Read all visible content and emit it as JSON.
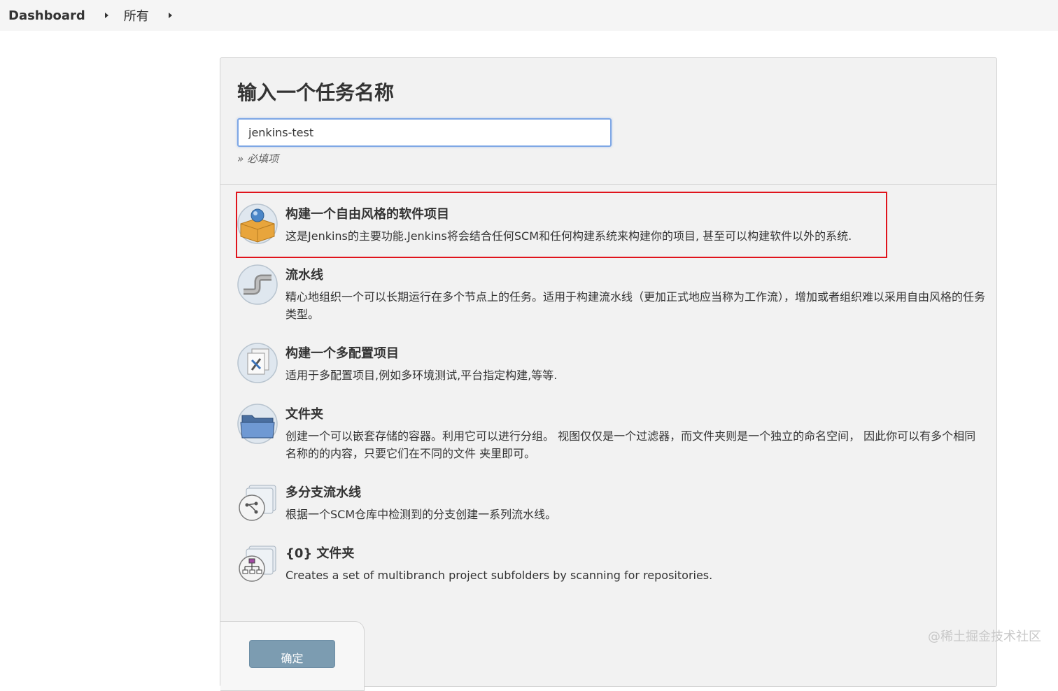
{
  "breadcrumb": {
    "items": [
      "Dashboard",
      "所有"
    ]
  },
  "form": {
    "title": "输入一个任务名称",
    "name_value": "jenkins-test",
    "required_hint": "» 必填项"
  },
  "items": [
    {
      "icon": "freestyle-project-icon",
      "title": "构建一个自由风格的软件项目",
      "desc": "这是Jenkins的主要功能.Jenkins将会结合任何SCM和任何构建系统来构建你的项目, 甚至可以构建软件以外的系统."
    },
    {
      "icon": "pipeline-icon",
      "title": "流水线",
      "desc": "精心地组织一个可以长期运行在多个节点上的任务。适用于构建流水线（更加正式地应当称为工作流），增加或者组织难以采用自由风格的任务类型。"
    },
    {
      "icon": "multi-config-project-icon",
      "title": "构建一个多配置项目",
      "desc": "适用于多配置项目,例如多环境测试,平台指定构建,等等."
    },
    {
      "icon": "folder-icon",
      "title": "文件夹",
      "desc": "创建一个可以嵌套存储的容器。利用它可以进行分组。 视图仅仅是一个过滤器，而文件夹则是一个独立的命名空间， 因此你可以有多个相同名称的的内容，只要它们在不同的文件 夹里即可。"
    },
    {
      "icon": "multibranch-pipeline-icon",
      "title": "多分支流水线",
      "desc": "根据一个SCM仓库中检测到的分支创建一系列流水线。"
    },
    {
      "icon": "organization-folder-icon",
      "title": "{0} 文件夹",
      "desc": "Creates a set of multibranch project subfolders by scanning for repositories."
    }
  ],
  "footer": {
    "ok_label": "确定"
  },
  "watermark": "@稀土掘金技术社区",
  "colors": {
    "highlight": "#e0141c",
    "input_border": "#7ea7e5",
    "ok_button": "#7c9cb1"
  }
}
